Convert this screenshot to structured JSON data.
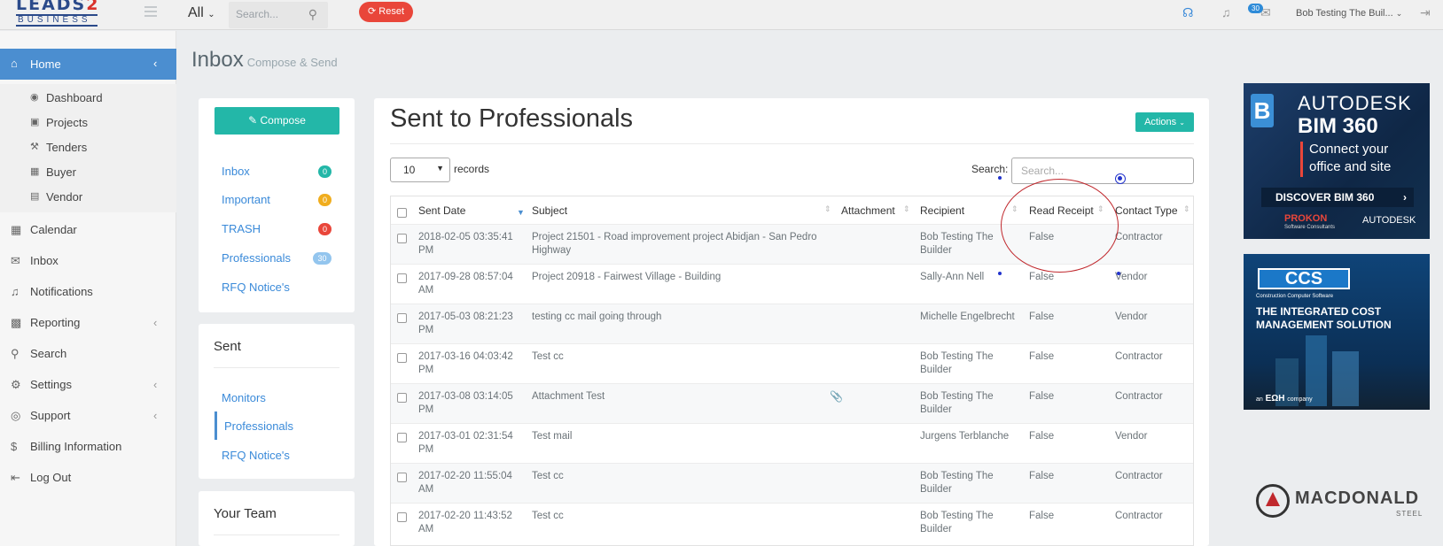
{
  "brand": {
    "line1_a": "LEADS",
    "line1_b": "2",
    "line2": "BUSINESS"
  },
  "topbar": {
    "scope": "All",
    "search_placeholder": "Search...",
    "reset_label": "Reset",
    "notification_count": "30",
    "user_name": "Bob Testing The Buil..."
  },
  "sidebar": {
    "home": "Home",
    "sub_items": [
      {
        "label": "Dashboard",
        "icon": "dashboard-icon"
      },
      {
        "label": "Projects",
        "icon": "briefcase-icon"
      },
      {
        "label": "Tenders",
        "icon": "gavel-icon"
      },
      {
        "label": "Buyer",
        "icon": "building-icon"
      },
      {
        "label": "Vendor",
        "icon": "store-icon"
      }
    ],
    "items": [
      {
        "label": "Calendar",
        "icon": "calendar-icon"
      },
      {
        "label": "Inbox",
        "icon": "envelope-icon"
      },
      {
        "label": "Notifications",
        "icon": "bell-icon"
      },
      {
        "label": "Reporting",
        "icon": "bar-chart-icon"
      },
      {
        "label": "Search",
        "icon": "search-icon"
      },
      {
        "label": "Settings",
        "icon": "gear-icon"
      },
      {
        "label": "Support",
        "icon": "lifebuoy-icon"
      },
      {
        "label": "Billing Information",
        "icon": "dollar-icon"
      },
      {
        "label": "Log Out",
        "icon": "logout-icon"
      }
    ]
  },
  "page": {
    "title": "Inbox",
    "subtitle": "Compose & Send"
  },
  "mail": {
    "compose_label": "Compose",
    "folders": [
      {
        "label": "Inbox",
        "count": "0",
        "color": "#23b7a8"
      },
      {
        "label": "Important",
        "count": "0",
        "color": "#f0ad1e"
      },
      {
        "label": "TRASH",
        "count": "0",
        "color": "#e9463a"
      },
      {
        "label": "Professionals",
        "count": "30",
        "color": "#93c5ee"
      },
      {
        "label": "RFQ Notice's",
        "count": "",
        "color": ""
      }
    ],
    "sent_header": "Sent",
    "sent_items": [
      "Monitors",
      "Professionals",
      "RFQ Notice's"
    ],
    "team_header": "Your Team"
  },
  "table": {
    "title": "Sent to Professionals",
    "actions_label": "Actions",
    "page_length": "10",
    "records_label": "records",
    "search_label": "Search:",
    "search_placeholder": "Search...",
    "columns": [
      "Sent Date",
      "Subject",
      "Attachment",
      "Recipient",
      "Read Receipt",
      "Contact Type"
    ],
    "rows": [
      {
        "date1": "2018-02-05 03:35:41",
        "date2": "PM",
        "subject1": "Project 21501 - Road improvement project Abidjan - San Pedro",
        "subject2": "Highway",
        "attachment": "",
        "recipient1": "Bob Testing The",
        "recipient2": "Builder",
        "read": "False",
        "type": "Contractor"
      },
      {
        "date1": "2017-09-28 08:57:04",
        "date2": "AM",
        "subject1": "Project 20918 - Fairwest Village - Building",
        "subject2": "",
        "attachment": "",
        "recipient1": "Sally-Ann Nell",
        "recipient2": "",
        "read": "False",
        "type": "Vendor"
      },
      {
        "date1": "2017-05-03 08:21:23",
        "date2": "PM",
        "subject1": "testing cc mail going through",
        "subject2": "",
        "attachment": "",
        "recipient1": "Michelle Engelbrecht",
        "recipient2": "",
        "read": "False",
        "type": "Vendor"
      },
      {
        "date1": "2017-03-16 04:03:42",
        "date2": "PM",
        "subject1": "Test cc",
        "subject2": "",
        "attachment": "",
        "recipient1": "Bob Testing The",
        "recipient2": "Builder",
        "read": "False",
        "type": "Contractor"
      },
      {
        "date1": "2017-03-08 03:14:05",
        "date2": "PM",
        "subject1": "Attachment Test",
        "subject2": "",
        "attachment": "paperclip-icon",
        "recipient1": "Bob Testing The",
        "recipient2": "Builder",
        "read": "False",
        "type": "Contractor"
      },
      {
        "date1": "2017-03-01 02:31:54",
        "date2": "PM",
        "subject1": "Test mail",
        "subject2": "",
        "attachment": "",
        "recipient1": "Jurgens Terblanche",
        "recipient2": "",
        "read": "False",
        "type": "Vendor"
      },
      {
        "date1": "2017-02-20 11:55:04",
        "date2": "AM",
        "subject1": "Test cc",
        "subject2": "",
        "attachment": "",
        "recipient1": "Bob Testing The",
        "recipient2": "Builder",
        "read": "False",
        "type": "Contractor"
      },
      {
        "date1": "2017-02-20 11:43:52",
        "date2": "AM",
        "subject1": "Test cc",
        "subject2": "",
        "attachment": "",
        "recipient1": "Bob Testing The",
        "recipient2": "Builder",
        "read": "False",
        "type": "Contractor"
      }
    ]
  },
  "ads": {
    "autodesk": {
      "brand": "AUTODESK",
      "product": "BIM 360",
      "line1": "Connect your",
      "line2": "office and site",
      "cta": "DISCOVER BIM 360",
      "partner": "PROKON",
      "partner_sub": "Software Consultants",
      "footer": "AUTODESK"
    },
    "ccs": {
      "logo": "CCS",
      "company": "Construction Computer Software",
      "line1": "THE INTEGRATED COST",
      "line2": "MANAGEMENT SOLUTION",
      "footer_prefix": "an",
      "footer_brand": "EΩH",
      "footer_suffix": "company"
    },
    "macdonald": {
      "name": "MACDONALD",
      "sub": "STEEL"
    }
  }
}
